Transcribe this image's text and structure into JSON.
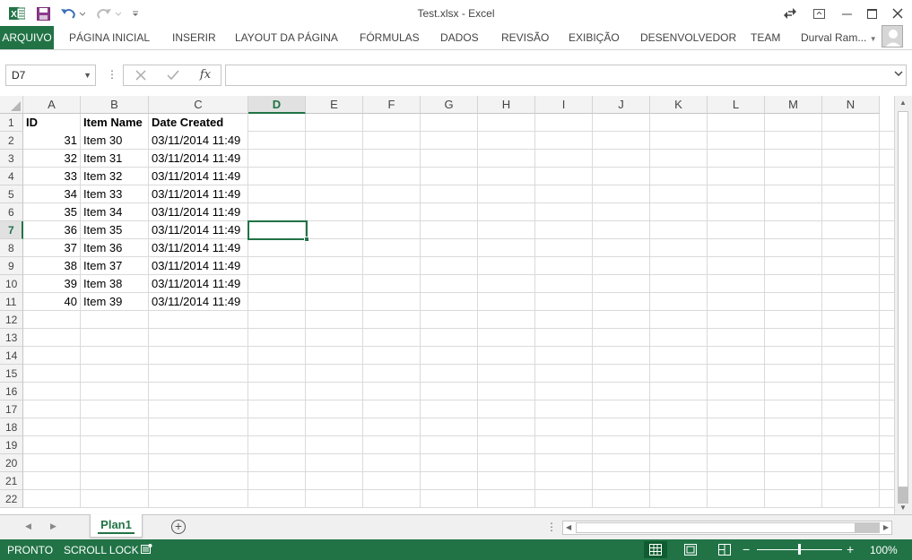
{
  "window": {
    "title": "Test.xlsx - Excel"
  },
  "quick_access": {
    "icons": [
      "excel-logo-icon",
      "save-icon",
      "undo-icon",
      "redo-icon",
      "customize-qat-icon"
    ]
  },
  "ribbon": {
    "tabs": [
      "ARQUIVO",
      "PÁGINA INICIAL",
      "INSERIR",
      "LAYOUT DA PÁGINA",
      "FÓRMULAS",
      "DADOS",
      "REVISÃO",
      "EXIBIÇÃO",
      "DESENVOLVEDOR",
      "TEAM"
    ],
    "user_name": "Durval Ram...",
    "accent_color": "#217346"
  },
  "formula_bar": {
    "name_box": "D7",
    "formula": "",
    "fx_label": "fx"
  },
  "sheet": {
    "columns": [
      "A",
      "B",
      "C",
      "D",
      "E",
      "F",
      "G",
      "H",
      "I",
      "J",
      "K",
      "L",
      "M",
      "N"
    ],
    "active_column": "D",
    "active_row": "7",
    "rows": [
      "1",
      "2",
      "3",
      "4",
      "5",
      "6",
      "7",
      "8",
      "9",
      "10",
      "11",
      "12",
      "13",
      "14",
      "15",
      "16",
      "17",
      "18",
      "19",
      "20",
      "21",
      "22"
    ],
    "header": [
      "ID",
      "Item Name",
      "Date Created"
    ],
    "data": [
      [
        "31",
        "Item 30",
        "03/11/2014 11:49"
      ],
      [
        "32",
        "Item 31",
        "03/11/2014 11:49"
      ],
      [
        "33",
        "Item 32",
        "03/11/2014 11:49"
      ],
      [
        "34",
        "Item 33",
        "03/11/2014 11:49"
      ],
      [
        "35",
        "Item 34",
        "03/11/2014 11:49"
      ],
      [
        "36",
        "Item 35",
        "03/11/2014 11:49"
      ],
      [
        "37",
        "Item 36",
        "03/11/2014 11:49"
      ],
      [
        "38",
        "Item 37",
        "03/11/2014 11:49"
      ],
      [
        "39",
        "Item 38",
        "03/11/2014 11:49"
      ],
      [
        "40",
        "Item 39",
        "03/11/2014 11:49"
      ]
    ]
  },
  "sheet_tabs": {
    "active": "Plan1"
  },
  "status_bar": {
    "mode": "PRONTO",
    "scroll_lock": "SCROLL LOCK",
    "zoom": "100%"
  }
}
